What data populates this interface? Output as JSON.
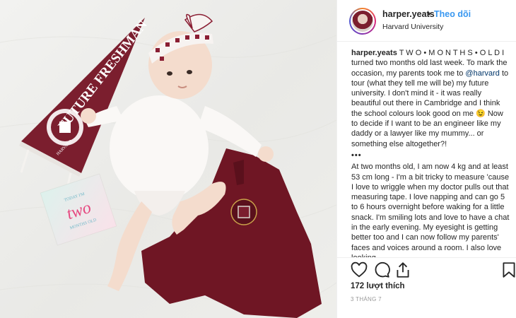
{
  "post": {
    "header": {
      "username": "harper.yeats",
      "separator": "•",
      "follow_label": "Theo dõi",
      "location": "Harvard University"
    },
    "photo": {
      "pennant_text": "FUTURE FRESHMAN",
      "pennant_seal_text": "HARVARD",
      "card_line1": "TODAY I'M",
      "card_line2": "two",
      "card_line3": "MONTHS OLD"
    },
    "caption": {
      "username": "harper.yeats",
      "title": "T W O • M O N T H S • O L D",
      "para1_a": "I turned two months old last week. To mark the occasion, my parents took me to ",
      "mention": "@harvard",
      "para1_b": " to tour (what they tell me will be) my future university. I don't mind it - it was really beautiful out there in Cambridge and I think the school colours look good on me 😉 Now to decide if I want to be an engineer like my daddy or a lawyer like my mummy... or something else altogether?!",
      "more": "•••",
      "para2": "At two months old, I am now 4 kg and at least 53 cm long - I'm a bit tricky to measure 'cause I love to wriggle when my doctor pulls out that measuring tape. I love napping and can go 5 to 6 hours overnight before waking for a little snack. I'm smiling lots and love to have a chat in the early evening. My eyesight is getting better too and I can now follow my parents' faces and voices around a room. I also love looking"
    },
    "actions": {
      "icons": [
        "heart-icon",
        "comment-icon",
        "share-icon",
        "bookmark-icon"
      ],
      "likes": "172 lượt thích",
      "date": "3 THÁNG 7"
    },
    "colors": {
      "link": "#3897f0",
      "mention": "#003569",
      "harvard_crimson": "#7b1e2e",
      "text": "#262626",
      "muted": "#999999"
    }
  }
}
